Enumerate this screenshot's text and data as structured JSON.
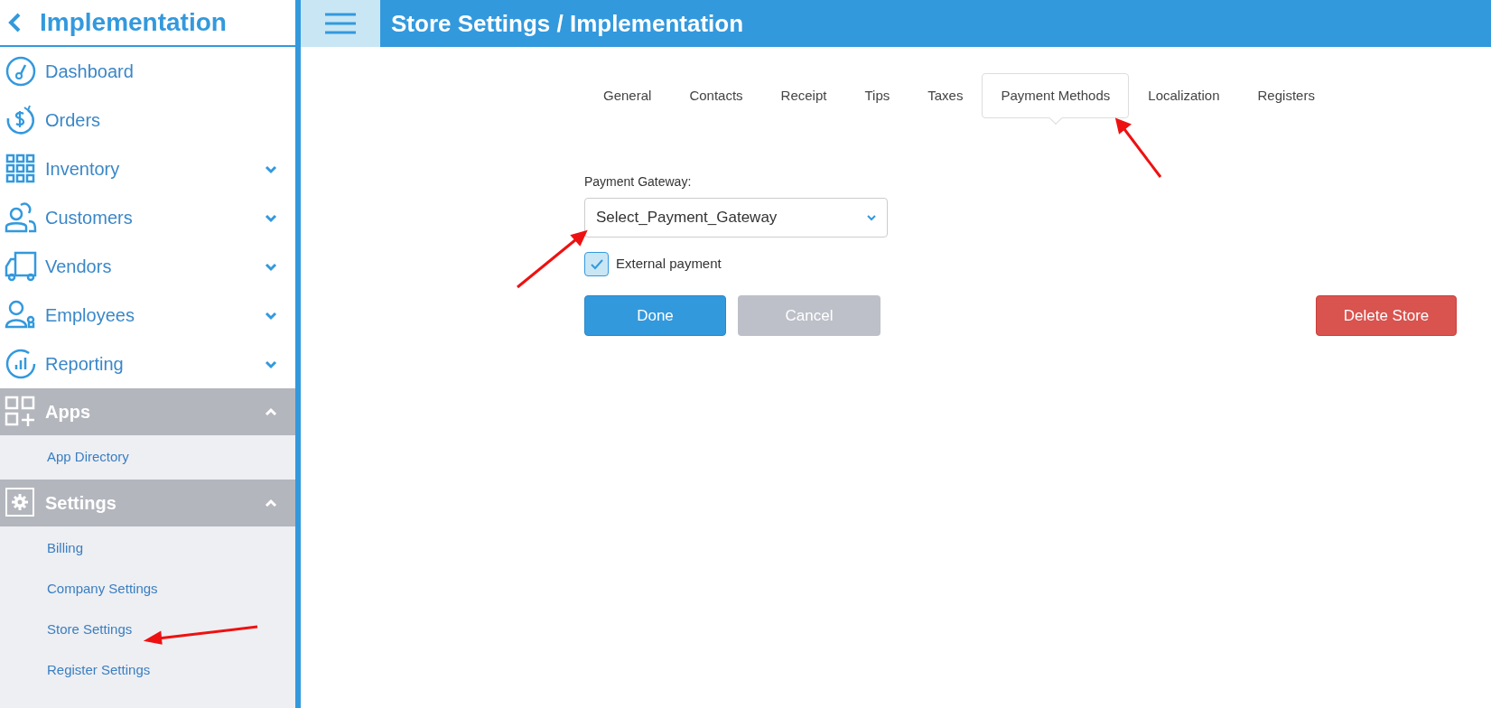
{
  "sidebar": {
    "title": "Implementation",
    "items": [
      {
        "label": "Dashboard",
        "kind": "link"
      },
      {
        "label": "Orders",
        "kind": "link"
      },
      {
        "label": "Inventory",
        "kind": "menu",
        "expanded": false
      },
      {
        "label": "Customers",
        "kind": "menu",
        "expanded": false
      },
      {
        "label": "Vendors",
        "kind": "menu",
        "expanded": false
      },
      {
        "label": "Employees",
        "kind": "menu",
        "expanded": false
      },
      {
        "label": "Reporting",
        "kind": "menu",
        "expanded": false
      }
    ],
    "sections": [
      {
        "label": "Apps",
        "expanded": true,
        "items": [
          "App Directory"
        ]
      },
      {
        "label": "Settings",
        "expanded": true,
        "items": [
          "Billing",
          "Company Settings",
          "Store Settings",
          "Register Settings"
        ]
      }
    ]
  },
  "header": {
    "title": "Store Settings / Implementation"
  },
  "tabs": [
    {
      "label": "General",
      "selected": false
    },
    {
      "label": "Contacts",
      "selected": false
    },
    {
      "label": "Receipt",
      "selected": false
    },
    {
      "label": "Tips",
      "selected": false
    },
    {
      "label": "Taxes",
      "selected": false
    },
    {
      "label": "Payment Methods",
      "selected": true
    },
    {
      "label": "Localization",
      "selected": false
    },
    {
      "label": "Registers",
      "selected": false
    }
  ],
  "form": {
    "gateway_label": "Payment Gateway:",
    "gateway_value": "Select_Payment_Gateway",
    "external_payment": {
      "label": "External payment",
      "checked": true
    }
  },
  "buttons": [
    {
      "label": "Done",
      "kind": "primary"
    },
    {
      "label": "Cancel",
      "kind": "secondary"
    },
    {
      "label": "Delete Store",
      "kind": "danger"
    }
  ]
}
